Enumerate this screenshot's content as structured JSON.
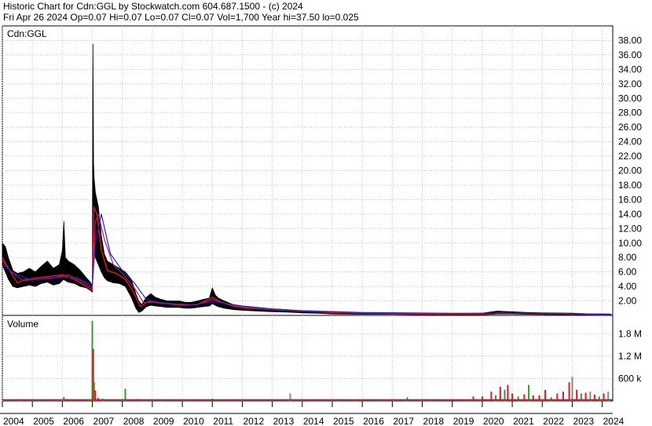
{
  "header": {
    "line1": "Historic Chart for Cdn:GGL by Stockwatch.com 604.687.1500 - (c) 2024",
    "line2": "Fri Apr 26 2024   Op=0.07  Hi=0.07  Lo=0.07  Cl=0.07  Vol=1,700  Year hi=37.50  lo=0.025"
  },
  "chart_data": [
    {
      "type": "line",
      "title": "Cdn:GGL",
      "ylim": [
        0,
        40
      ],
      "yticks": [
        2,
        4,
        6,
        8,
        10,
        12,
        14,
        16,
        18,
        20,
        22,
        24,
        26,
        28,
        30,
        32,
        34,
        36,
        38
      ],
      "ytick_labels": [
        "2.00",
        "4.00",
        "6.00",
        "8.00",
        "10.00",
        "12.00",
        "14.00",
        "16.00",
        "18.00",
        "20.00",
        "22.00",
        "24.00",
        "26.00",
        "28.00",
        "30.00",
        "32.00",
        "34.00",
        "36.00",
        "38.00"
      ],
      "x_range": [
        2004.0,
        2024.35
      ],
      "xticks": [
        2004,
        2005,
        2006,
        2007,
        2008,
        2009,
        2010,
        2011,
        2012,
        2013,
        2014,
        2015,
        2016,
        2017,
        2018,
        2019,
        2020,
        2021,
        2022,
        2023,
        2024
      ],
      "xtick_labels": [
        "2004",
        "2005",
        "2006",
        "2007",
        "2008",
        "2009",
        "2010",
        "2011",
        "2012",
        "2013",
        "2014",
        "2015",
        "2016",
        "2017",
        "2018",
        "2019",
        "2020",
        "2021",
        "2022",
        "2023",
        "2024"
      ],
      "grid": true,
      "series": [
        {
          "key": "high_low",
          "color": "#000000",
          "x": [
            2004.0,
            2004.1,
            2004.2,
            2004.35,
            2004.5,
            2004.7,
            2004.9,
            2005.1,
            2005.3,
            2005.5,
            2005.7,
            2005.9,
            2006.0,
            2006.05,
            2006.1,
            2006.2,
            2006.4,
            2006.6,
            2006.8,
            2006.95,
            2007.0,
            2007.02,
            2007.04,
            2007.06,
            2007.1,
            2007.2,
            2007.3,
            2007.4,
            2007.5,
            2007.7,
            2007.9,
            2008.1,
            2008.3,
            2008.45,
            2008.55,
            2008.65,
            2008.8,
            2008.95,
            2009.1,
            2009.3,
            2009.5,
            2009.7,
            2009.9,
            2010.1,
            2010.3,
            2010.5,
            2010.7,
            2010.9,
            2011.0,
            2011.1,
            2011.2,
            2011.4,
            2011.7,
            2012.0,
            2012.5,
            2013.0,
            2013.5,
            2014.0,
            2014.5,
            2015.0,
            2016.0,
            2017.0,
            2018.0,
            2019.0,
            2020.0,
            2020.5,
            2021.0,
            2021.5,
            2022.0,
            2023.0,
            2024.3
          ],
          "high": [
            10.0,
            9.5,
            8.0,
            6.2,
            5.8,
            6.0,
            6.5,
            6.0,
            6.8,
            7.5,
            6.5,
            7.0,
            9.0,
            13.0,
            8.0,
            7.5,
            7.0,
            6.2,
            5.2,
            4.5,
            4.0,
            37.5,
            21.0,
            19.0,
            17.0,
            15.0,
            11.0,
            8.5,
            7.5,
            7.0,
            6.5,
            6.0,
            5.0,
            3.0,
            2.0,
            1.5,
            2.5,
            3.0,
            2.5,
            2.2,
            2.0,
            2.0,
            2.0,
            1.8,
            1.8,
            2.0,
            2.2,
            2.4,
            3.8,
            2.8,
            2.4,
            2.0,
            1.5,
            1.2,
            1.0,
            0.9,
            0.8,
            0.6,
            0.5,
            0.4,
            0.3,
            0.3,
            0.25,
            0.25,
            0.3,
            0.6,
            0.5,
            0.4,
            0.35,
            0.3,
            0.1
          ],
          "low": [
            7.0,
            6.0,
            5.0,
            4.0,
            3.8,
            4.0,
            4.2,
            4.0,
            4.4,
            4.6,
            4.2,
            4.4,
            4.8,
            5.0,
            4.8,
            4.6,
            4.4,
            4.0,
            3.8,
            3.4,
            3.2,
            8.0,
            11.0,
            10.0,
            8.0,
            7.0,
            6.0,
            5.2,
            4.8,
            4.5,
            4.4,
            4.0,
            2.5,
            1.0,
            0.4,
            0.6,
            1.2,
            1.4,
            1.3,
            1.2,
            1.1,
            1.1,
            1.1,
            1.0,
            1.0,
            1.1,
            1.2,
            1.3,
            1.6,
            1.4,
            1.2,
            1.0,
            0.8,
            0.7,
            0.6,
            0.5,
            0.45,
            0.35,
            0.3,
            0.2,
            0.15,
            0.15,
            0.1,
            0.1,
            0.1,
            0.2,
            0.2,
            0.15,
            0.12,
            0.1,
            0.025
          ]
        },
        {
          "key": "close",
          "color": "#e8132b",
          "x": [
            2004.0,
            2004.2,
            2004.5,
            2004.8,
            2005.2,
            2005.6,
            2006.0,
            2006.4,
            2006.8,
            2007.0,
            2007.05,
            2007.15,
            2007.3,
            2007.5,
            2007.8,
            2008.1,
            2008.4,
            2008.6,
            2008.8,
            2009.0,
            2009.5,
            2010.0,
            2010.5,
            2011.0,
            2011.3,
            2011.7,
            2012.0,
            2013.0,
            2014.0,
            2015.0,
            2016.0,
            2018.0,
            2020.0,
            2020.6,
            2021.0,
            2022.0,
            2023.0,
            2024.3
          ],
          "y": [
            8.0,
            6.5,
            4.5,
            5.0,
            5.2,
            5.4,
            5.6,
            5.0,
            4.0,
            3.5,
            15.0,
            14.0,
            9.0,
            6.2,
            5.8,
            5.0,
            3.0,
            1.2,
            1.8,
            2.0,
            1.6,
            1.4,
            1.5,
            2.5,
            1.8,
            1.3,
            1.1,
            0.8,
            0.6,
            0.4,
            0.3,
            0.2,
            0.2,
            0.35,
            0.3,
            0.25,
            0.2,
            0.07
          ]
        },
        {
          "key": "ma_short",
          "color": "#b01a6c",
          "x": [
            2004.0,
            2004.3,
            2004.7,
            2005.2,
            2005.7,
            2006.2,
            2006.7,
            2007.0,
            2007.1,
            2007.2,
            2007.4,
            2007.7,
            2008.0,
            2008.4,
            2008.7,
            2009.0,
            2009.5,
            2010.0,
            2010.5,
            2011.0,
            2011.5,
            2012.0,
            2013.0,
            2014.0,
            2016.0,
            2019.0,
            2021.0,
            2024.3
          ],
          "y": [
            7.5,
            6.0,
            4.8,
            5.0,
            5.2,
            5.6,
            4.6,
            3.8,
            13.0,
            14.0,
            10.5,
            7.0,
            5.8,
            3.8,
            1.8,
            1.8,
            1.6,
            1.5,
            1.5,
            2.2,
            1.6,
            1.2,
            0.8,
            0.6,
            0.35,
            0.25,
            0.3,
            0.12
          ]
        },
        {
          "key": "ma_long",
          "color": "#2323c8",
          "x": [
            2004.0,
            2004.4,
            2004.9,
            2005.4,
            2006.0,
            2006.5,
            2007.0,
            2007.1,
            2007.3,
            2007.6,
            2008.0,
            2008.4,
            2008.8,
            2009.2,
            2009.8,
            2010.4,
            2011.0,
            2011.5,
            2012.0,
            2013.0,
            2014.0,
            2016.0,
            2019.0,
            2021.0,
            2024.3
          ],
          "y": [
            7.0,
            5.8,
            5.0,
            5.0,
            5.3,
            5.2,
            4.2,
            10.0,
            14.0,
            8.5,
            6.2,
            4.5,
            2.2,
            1.8,
            1.6,
            1.5,
            1.9,
            1.6,
            1.3,
            0.9,
            0.65,
            0.4,
            0.28,
            0.3,
            0.18
          ]
        }
      ]
    },
    {
      "type": "bar",
      "title": "Volume",
      "ylim": [
        0,
        2300000
      ],
      "yticks": [
        600000,
        1200000,
        1800000
      ],
      "ytick_labels": [
        "600 k",
        "1.2 M",
        "1.8 M"
      ],
      "x_range": [
        2004.0,
        2024.35
      ],
      "grid": true,
      "bars": [
        {
          "x": 2004.05,
          "value": 20000,
          "color": "#e8132b"
        },
        {
          "x": 2004.6,
          "value": 15000,
          "color": "#e8132b"
        },
        {
          "x": 2005.2,
          "value": 18000,
          "color": "#2ca02c"
        },
        {
          "x": 2005.8,
          "value": 15000,
          "color": "#e8132b"
        },
        {
          "x": 2006.05,
          "value": 110000,
          "color": "#2ca02c"
        },
        {
          "x": 2006.15,
          "value": 50000,
          "color": "#e8132b"
        },
        {
          "x": 2006.6,
          "value": 25000,
          "color": "#e8132b"
        },
        {
          "x": 2006.9,
          "value": 40000,
          "color": "#2ca02c"
        },
        {
          "x": 2007.0,
          "value": 2150000,
          "color": "#2ca02c"
        },
        {
          "x": 2007.03,
          "value": 1400000,
          "color": "#e8132b"
        },
        {
          "x": 2007.06,
          "value": 500000,
          "color": "#2ca02c"
        },
        {
          "x": 2007.1,
          "value": 280000,
          "color": "#e8132b"
        },
        {
          "x": 2007.2,
          "value": 80000,
          "color": "#e8132b"
        },
        {
          "x": 2007.35,
          "value": 60000,
          "color": "#2ca02c"
        },
        {
          "x": 2008.1,
          "value": 330000,
          "color": "#2ca02c"
        },
        {
          "x": 2008.5,
          "value": 50000,
          "color": "#e8132b"
        },
        {
          "x": 2008.7,
          "value": 30000,
          "color": "#2ca02c"
        },
        {
          "x": 2009.3,
          "value": 40000,
          "color": "#2ca02c"
        },
        {
          "x": 2010.3,
          "value": 25000,
          "color": "#e8132b"
        },
        {
          "x": 2011.0,
          "value": 60000,
          "color": "#2ca02c"
        },
        {
          "x": 2011.6,
          "value": 25000,
          "color": "#e8132b"
        },
        {
          "x": 2013.6,
          "value": 200000,
          "color": "#888888"
        },
        {
          "x": 2014.2,
          "value": 30000,
          "color": "#e8132b"
        },
        {
          "x": 2015.2,
          "value": 30000,
          "color": "#2ca02c"
        },
        {
          "x": 2016.0,
          "value": 40000,
          "color": "#e8132b"
        },
        {
          "x": 2016.5,
          "value": 25000,
          "color": "#2ca02c"
        },
        {
          "x": 2017.1,
          "value": 40000,
          "color": "#e8132b"
        },
        {
          "x": 2017.5,
          "value": 100000,
          "color": "#2ca02c"
        },
        {
          "x": 2017.8,
          "value": 40000,
          "color": "#e8132b"
        },
        {
          "x": 2018.3,
          "value": 25000,
          "color": "#2ca02c"
        },
        {
          "x": 2019.0,
          "value": 30000,
          "color": "#e8132b"
        },
        {
          "x": 2019.5,
          "value": 25000,
          "color": "#2ca02c"
        },
        {
          "x": 2019.7,
          "value": 120000,
          "color": "#e8132b"
        },
        {
          "x": 2020.0,
          "value": 120000,
          "color": "#e8132b"
        },
        {
          "x": 2020.3,
          "value": 250000,
          "color": "#e8132b"
        },
        {
          "x": 2020.45,
          "value": 150000,
          "color": "#2ca02c"
        },
        {
          "x": 2020.6,
          "value": 380000,
          "color": "#e8132b"
        },
        {
          "x": 2020.75,
          "value": 300000,
          "color": "#2ca02c"
        },
        {
          "x": 2020.85,
          "value": 430000,
          "color": "#e8132b"
        },
        {
          "x": 2021.0,
          "value": 200000,
          "color": "#e8132b"
        },
        {
          "x": 2021.2,
          "value": 120000,
          "color": "#2ca02c"
        },
        {
          "x": 2021.4,
          "value": 180000,
          "color": "#e8132b"
        },
        {
          "x": 2021.55,
          "value": 430000,
          "color": "#2ca02c"
        },
        {
          "x": 2021.7,
          "value": 150000,
          "color": "#e8132b"
        },
        {
          "x": 2021.9,
          "value": 150000,
          "color": "#e8132b"
        },
        {
          "x": 2022.1,
          "value": 300000,
          "color": "#e8132b"
        },
        {
          "x": 2022.3,
          "value": 100000,
          "color": "#2ca02c"
        },
        {
          "x": 2022.5,
          "value": 200000,
          "color": "#e8132b"
        },
        {
          "x": 2022.7,
          "value": 250000,
          "color": "#e8132b"
        },
        {
          "x": 2022.9,
          "value": 500000,
          "color": "#e8132b"
        },
        {
          "x": 2023.0,
          "value": 650000,
          "color": "#888888"
        },
        {
          "x": 2023.15,
          "value": 300000,
          "color": "#e8132b"
        },
        {
          "x": 2023.3,
          "value": 200000,
          "color": "#2ca02c"
        },
        {
          "x": 2023.45,
          "value": 220000,
          "color": "#e8132b"
        },
        {
          "x": 2023.6,
          "value": 250000,
          "color": "#888888"
        },
        {
          "x": 2023.75,
          "value": 170000,
          "color": "#e8132b"
        },
        {
          "x": 2023.9,
          "value": 120000,
          "color": "#2ca02c"
        },
        {
          "x": 2024.05,
          "value": 200000,
          "color": "#e8132b"
        },
        {
          "x": 2024.2,
          "value": 250000,
          "color": "#888888"
        }
      ]
    }
  ]
}
